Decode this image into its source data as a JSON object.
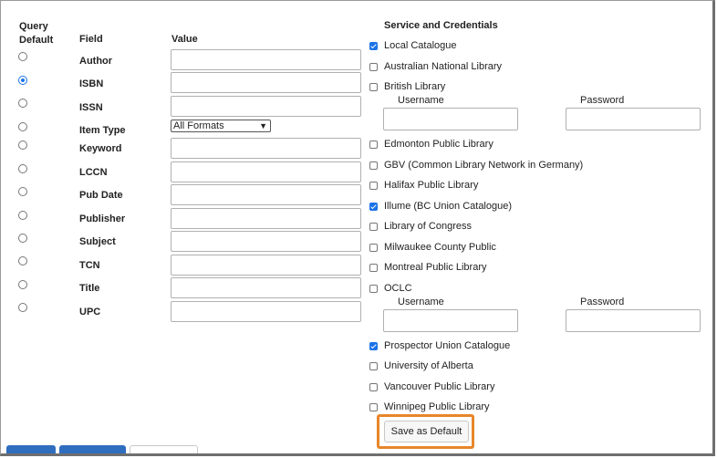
{
  "headers": {
    "query_default_line1": "Query",
    "query_default_line2": "Default",
    "field": "Field",
    "value": "Value",
    "service": "Service and Credentials"
  },
  "fields": [
    {
      "label": "Author",
      "selected": false
    },
    {
      "label": "ISBN",
      "selected": true
    },
    {
      "label": "ISSN",
      "selected": false
    },
    {
      "label": "Item Type",
      "selected": false
    },
    {
      "label": "Keyword",
      "selected": false
    },
    {
      "label": "LCCN",
      "selected": false
    },
    {
      "label": "Pub Date",
      "selected": false
    },
    {
      "label": "Publisher",
      "selected": false
    },
    {
      "label": "Subject",
      "selected": false
    },
    {
      "label": "TCN",
      "selected": false
    },
    {
      "label": "Title",
      "selected": false
    },
    {
      "label": "UPC",
      "selected": false
    }
  ],
  "item_type_select": {
    "value": "All Formats"
  },
  "services": [
    {
      "name": "Local Catalogue",
      "checked": true
    },
    {
      "name": "Australian National Library",
      "checked": false
    },
    {
      "name": "British Library",
      "checked": false
    },
    {
      "name": "Edmonton Public Library",
      "checked": false
    },
    {
      "name": "GBV (Common Library Network in Germany)",
      "checked": false
    },
    {
      "name": "Halifax Public Library",
      "checked": false
    },
    {
      "name": "Illume (BC Union Catalogue)",
      "checked": true
    },
    {
      "name": "Library of Congress",
      "checked": false
    },
    {
      "name": "Milwaukee County Public",
      "checked": false
    },
    {
      "name": "Montreal Public Library",
      "checked": false
    },
    {
      "name": "OCLC",
      "checked": false
    },
    {
      "name": "Prospector Union Catalogue",
      "checked": true
    },
    {
      "name": "University of Alberta",
      "checked": false
    },
    {
      "name": "Vancouver Public Library",
      "checked": false
    },
    {
      "name": "Winnipeg Public Library",
      "checked": false
    }
  ],
  "credentials": {
    "username_label": "Username",
    "password_label": "Password"
  },
  "save_button": {
    "label": "Save as Default",
    "highlight_color": "#e8862a"
  },
  "colors": {
    "accent": "#1a73e8",
    "bottom_button": "#2f6dbf"
  }
}
